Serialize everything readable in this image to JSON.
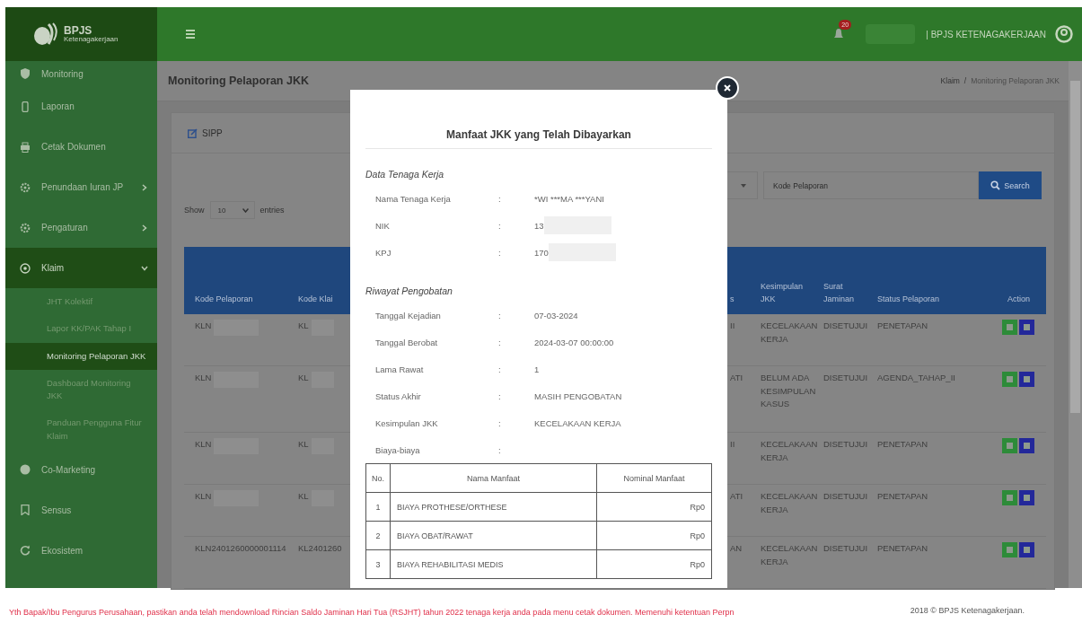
{
  "logo": {
    "name": "BPJS",
    "sub": "Ketenagakerjaan"
  },
  "header": {
    "notification_count": "20",
    "organization": "| BPJS KETENAGAKERJAAN"
  },
  "sidebar": {
    "items": [
      {
        "label": "Monitoring",
        "kind": "shield",
        "expandable": false,
        "expanded": false
      },
      {
        "label": "Laporan",
        "kind": "phone",
        "expandable": false,
        "expanded": false
      },
      {
        "label": "Cetak Dokumen",
        "kind": "printer",
        "expandable": false,
        "expanded": false
      },
      {
        "label": "Penundaan Iuran JP",
        "kind": "gear",
        "expandable": true,
        "expanded": false
      },
      {
        "label": "Pengaturan",
        "kind": "gear",
        "expandable": true,
        "expanded": false
      },
      {
        "label": "Klaim",
        "kind": "target",
        "expandable": true,
        "expanded": true,
        "children": [
          {
            "label": "JHT Kolektif",
            "selected": false
          },
          {
            "label": "Lapor KK/PAK Tahap I",
            "selected": false
          },
          {
            "label": "Monitoring Pelaporan JKK",
            "selected": true
          },
          {
            "label": "Dashboard Monitoring JKK",
            "selected": false
          },
          {
            "label": "Panduan Pengguna Fitur Klaim",
            "selected": false
          }
        ]
      },
      {
        "label": "Co-Marketing",
        "kind": "dot",
        "expandable": false,
        "expanded": false
      },
      {
        "label": "Sensus",
        "kind": "bookmark",
        "expandable": false,
        "expanded": false
      },
      {
        "label": "Ekosistem",
        "kind": "refresh",
        "expandable": false,
        "expanded": false
      }
    ]
  },
  "page": {
    "title": "Monitoring Pelaporan JKK",
    "breadcrumb": [
      "Klaim",
      "Monitoring Pelaporan JKK"
    ],
    "breadcrumb_separator": "/",
    "card_title": "SIPP",
    "search": {
      "placeholder": "Kode Pelaporan",
      "button": "Search"
    },
    "length": {
      "prefix": "Show",
      "value": "10",
      "suffix": "entries"
    }
  },
  "table": {
    "left_columns": [
      "Kode Pelaporan",
      "Kode Klai"
    ],
    "right_columns": [
      "s",
      "Kesimpulan JKK",
      "Surat Jaminan",
      "Status Pelaporan",
      "Action"
    ],
    "rows": [
      {
        "kode_pelaporan": "KLN",
        "kode_klaim": "KL",
        "redacted": true,
        "column_3": "II",
        "kesimpulan": "KECELAKAAN KERJA",
        "surat": "DISETUJUI",
        "status": "PENETAPAN"
      },
      {
        "kode_pelaporan": "KLN",
        "kode_klaim": "KL",
        "redacted": true,
        "column_3": "ATI",
        "kesimpulan": "BELUM ADA KESIMPULAN KASUS",
        "surat": "DISETUJUI",
        "status": "AGENDA_TAHAP_II"
      },
      {
        "kode_pelaporan": "KLN",
        "kode_klaim": "KL",
        "redacted": true,
        "column_3": "II",
        "kesimpulan": "KECELAKAAN KERJA",
        "surat": "DISETUJUI",
        "status": "PENETAPAN"
      },
      {
        "kode_pelaporan": "KLN",
        "kode_klaim": "KL",
        "redacted": true,
        "column_3": "ATI",
        "kesimpulan": "KECELAKAAN KERJA",
        "surat": "DISETUJUI",
        "status": "PENETAPAN"
      },
      {
        "kode_pelaporan": "KLN2401260000001114",
        "kode_klaim": "KL2401260",
        "column_3": "AN",
        "kesimpulan": "KECELAKAAN KERJA",
        "surat": "DISETUJUI",
        "status": "PENETAPAN"
      }
    ]
  },
  "modal": {
    "title": "Manfaat JKK yang Telah Dibayarkan",
    "field_separator": ":",
    "sections": [
      {
        "heading": "Data Tenaga Kerja",
        "fields": [
          {
            "label": "Nama Tenaga Kerja",
            "value": "*WI ***MA ***YANI"
          },
          {
            "label": "NIK",
            "value": "13",
            "redacted": true
          },
          {
            "label": "KPJ",
            "value": "170",
            "redacted": true
          }
        ]
      },
      {
        "heading": "Riwayat Pengobatan",
        "fields": [
          {
            "label": "Tanggal Kejadian",
            "value": "07-03-2024"
          },
          {
            "label": "Tanggal Berobat",
            "value": "2024-03-07 00:00:00"
          },
          {
            "label": "Lama Rawat",
            "value": "1"
          },
          {
            "label": "Status Akhir",
            "value": "MASIH PENGOBATAN"
          },
          {
            "label": "Kesimpulan JKK",
            "value": "KECELAKAAN KERJA"
          },
          {
            "label": "Biaya-biaya"
          }
        ]
      }
    ],
    "benefits": {
      "columns": [
        "No.",
        "Nama Manfaat",
        "Nominal Manfaat"
      ],
      "rows": [
        [
          "1",
          "BIAYA PROTHESE/ORTHESE",
          "Rp0"
        ],
        [
          "2",
          "BIAYA OBAT/RAWAT",
          "Rp0"
        ],
        [
          "3",
          "BIAYA REHABILITASI MEDIS",
          "Rp0"
        ]
      ]
    }
  },
  "footer": {
    "notice": "Yth Bapak/Ibu Pengurus Perusahaan, pastikan anda telah mendownload Rincian Saldo Jaminan Hari Tua (RSJHT) tahun 2022 tenaga kerja anda pada menu cetak dokumen. Memenuhi ketentuan Perpn",
    "copyright": "2018 © BPJS Ketenagakerjaan."
  }
}
